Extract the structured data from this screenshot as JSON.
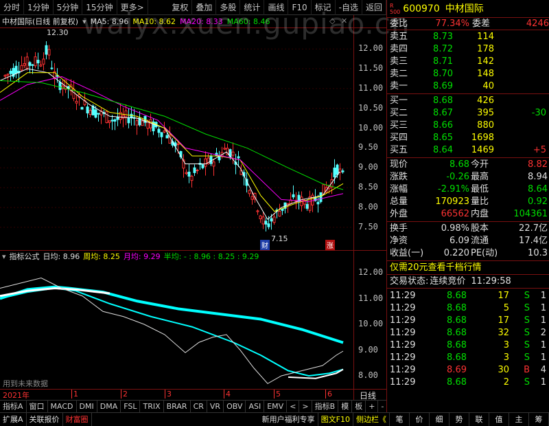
{
  "toolbar": {
    "items": [
      "分时",
      "1分钟",
      "5分钟",
      "15分钟",
      "更多>",
      "复权",
      "叠加",
      "多股",
      "统计",
      "画线",
      "F10",
      "标记",
      "-自选",
      "返回"
    ]
  },
  "watermark": "waiyx.xuen.gupiao.cn",
  "chart": {
    "stock_title": "中材国际(日线 前复权)",
    "ma5_label": "MA5: 8.96",
    "ma10_label": "MA10: 8.62",
    "ma20_label": "MA20: 8.33",
    "ma60_label": "MA60: 8.46",
    "high_mark": "12.30",
    "low_mark": "7.15",
    "badge_cai": "财",
    "badge_zhang": "涨",
    "price_ticks": [
      "12.00",
      "11.50",
      "11.00",
      "10.50",
      "10.00",
      "9.50",
      "9.00",
      "8.50",
      "8.00",
      "7.50"
    ]
  },
  "indicator": {
    "title": "指标公式",
    "ri": "日均: 8.96",
    "zhou": "周均: 8.25",
    "yue": "月均: 9.29",
    "ban": "半均: - : 8.96 : 8.25 : 9.29",
    "ticks": [
      "12.00",
      "11.00",
      "10.00",
      "9.00",
      "8.00"
    ],
    "footnote": "用到未来数据"
  },
  "xaxis": {
    "year": "2021年",
    "months": [
      "1",
      "2",
      "3",
      "4",
      "5",
      "6"
    ],
    "period": "日线"
  },
  "bottom_tabs": [
    "指标A",
    "窗口",
    "MACD",
    "DMI",
    "DMA",
    "FSL",
    "TRIX",
    "BRAR",
    "CR",
    "VR",
    "OBV",
    "ASI",
    "EMV",
    "<",
    ">",
    "指标B",
    "模",
    "板",
    "+",
    "-"
  ],
  "statusbar": {
    "left": [
      "扩展A",
      "关联报价",
      "财富圈"
    ],
    "mid": [
      "新用户福利专享",
      "图文F10",
      "侧边栏《"
    ],
    "right": [
      "笔",
      "价",
      "细",
      "势",
      "联",
      "值",
      "主",
      "筹"
    ]
  },
  "quote": {
    "r_label": "R",
    "code_sub": "500",
    "code": "600970",
    "name": "中材国际",
    "weibi_label": "委比",
    "weibi_value": "77.34%",
    "weicha_label": "委差",
    "weicha_value": "4246",
    "sells": [
      {
        "label": "卖五",
        "price": "8.73",
        "vol": "114"
      },
      {
        "label": "卖四",
        "price": "8.72",
        "vol": "178"
      },
      {
        "label": "卖三",
        "price": "8.71",
        "vol": "142"
      },
      {
        "label": "卖二",
        "price": "8.70",
        "vol": "148"
      },
      {
        "label": "卖一",
        "price": "8.69",
        "vol": "40"
      }
    ],
    "buys": [
      {
        "label": "买一",
        "price": "8.68",
        "vol": "426",
        "chg": ""
      },
      {
        "label": "买二",
        "price": "8.67",
        "vol": "395",
        "chg": "-30"
      },
      {
        "label": "买三",
        "price": "8.66",
        "vol": "880",
        "chg": ""
      },
      {
        "label": "买四",
        "price": "8.65",
        "vol": "1698",
        "chg": ""
      },
      {
        "label": "买五",
        "price": "8.64",
        "vol": "1469",
        "chg": "+5"
      }
    ],
    "stats": [
      {
        "l1": "现价",
        "v1": "8.68",
        "l2": "今开",
        "v2": "8.82",
        "c1": "green",
        "c2": "red"
      },
      {
        "l1": "涨跌",
        "v1": "-0.26",
        "l2": "最高",
        "v2": "8.94",
        "c1": "green",
        "c2": "white"
      },
      {
        "l1": "涨幅",
        "v1": "-2.91%",
        "l2": "最低",
        "v2": "8.64",
        "c1": "green",
        "c2": "green"
      },
      {
        "l1": "总量",
        "v1": "170923",
        "l2": "量比",
        "v2": "0.92",
        "c1": "yellow",
        "c2": "green"
      },
      {
        "l1": "外盘",
        "v1": "66562",
        "l2": "内盘",
        "v2": "104361",
        "c1": "red",
        "c2": "green"
      }
    ],
    "stats2": [
      {
        "l1": "换手",
        "v1": "0.98%",
        "l2": "股本",
        "v2": "22.7亿"
      },
      {
        "l1": "净资",
        "v1": "6.09",
        "l2": "流通",
        "v2": "17.4亿"
      },
      {
        "l1": "收益(一)",
        "v1": "0.220",
        "l2": "PE(动)",
        "v2": "10.3"
      }
    ],
    "ad_text": "仅需20元查看千档行情",
    "trade_status_label": "交易状态:",
    "trade_status_value": "连续竞价",
    "trade_status_time": "11:29:58",
    "ticks": [
      {
        "time": "11:29",
        "price": "8.68",
        "vol": "17",
        "bs": "S",
        "n": "1"
      },
      {
        "time": "11:29",
        "price": "8.68",
        "vol": "5",
        "bs": "S",
        "n": "1"
      },
      {
        "time": "11:29",
        "price": "8.68",
        "vol": "17",
        "bs": "S",
        "n": "1"
      },
      {
        "time": "11:29",
        "price": "8.68",
        "vol": "32",
        "bs": "S",
        "n": "2"
      },
      {
        "time": "11:29",
        "price": "8.68",
        "vol": "3",
        "bs": "S",
        "n": "1"
      },
      {
        "time": "11:29",
        "price": "8.68",
        "vol": "3",
        "bs": "S",
        "n": "1"
      },
      {
        "time": "11:29",
        "price": "8.69",
        "vol": "30",
        "bs": "B",
        "n": "4"
      },
      {
        "time": "11:29",
        "price": "8.68",
        "vol": "2",
        "bs": "S",
        "n": "1"
      }
    ]
  }
}
